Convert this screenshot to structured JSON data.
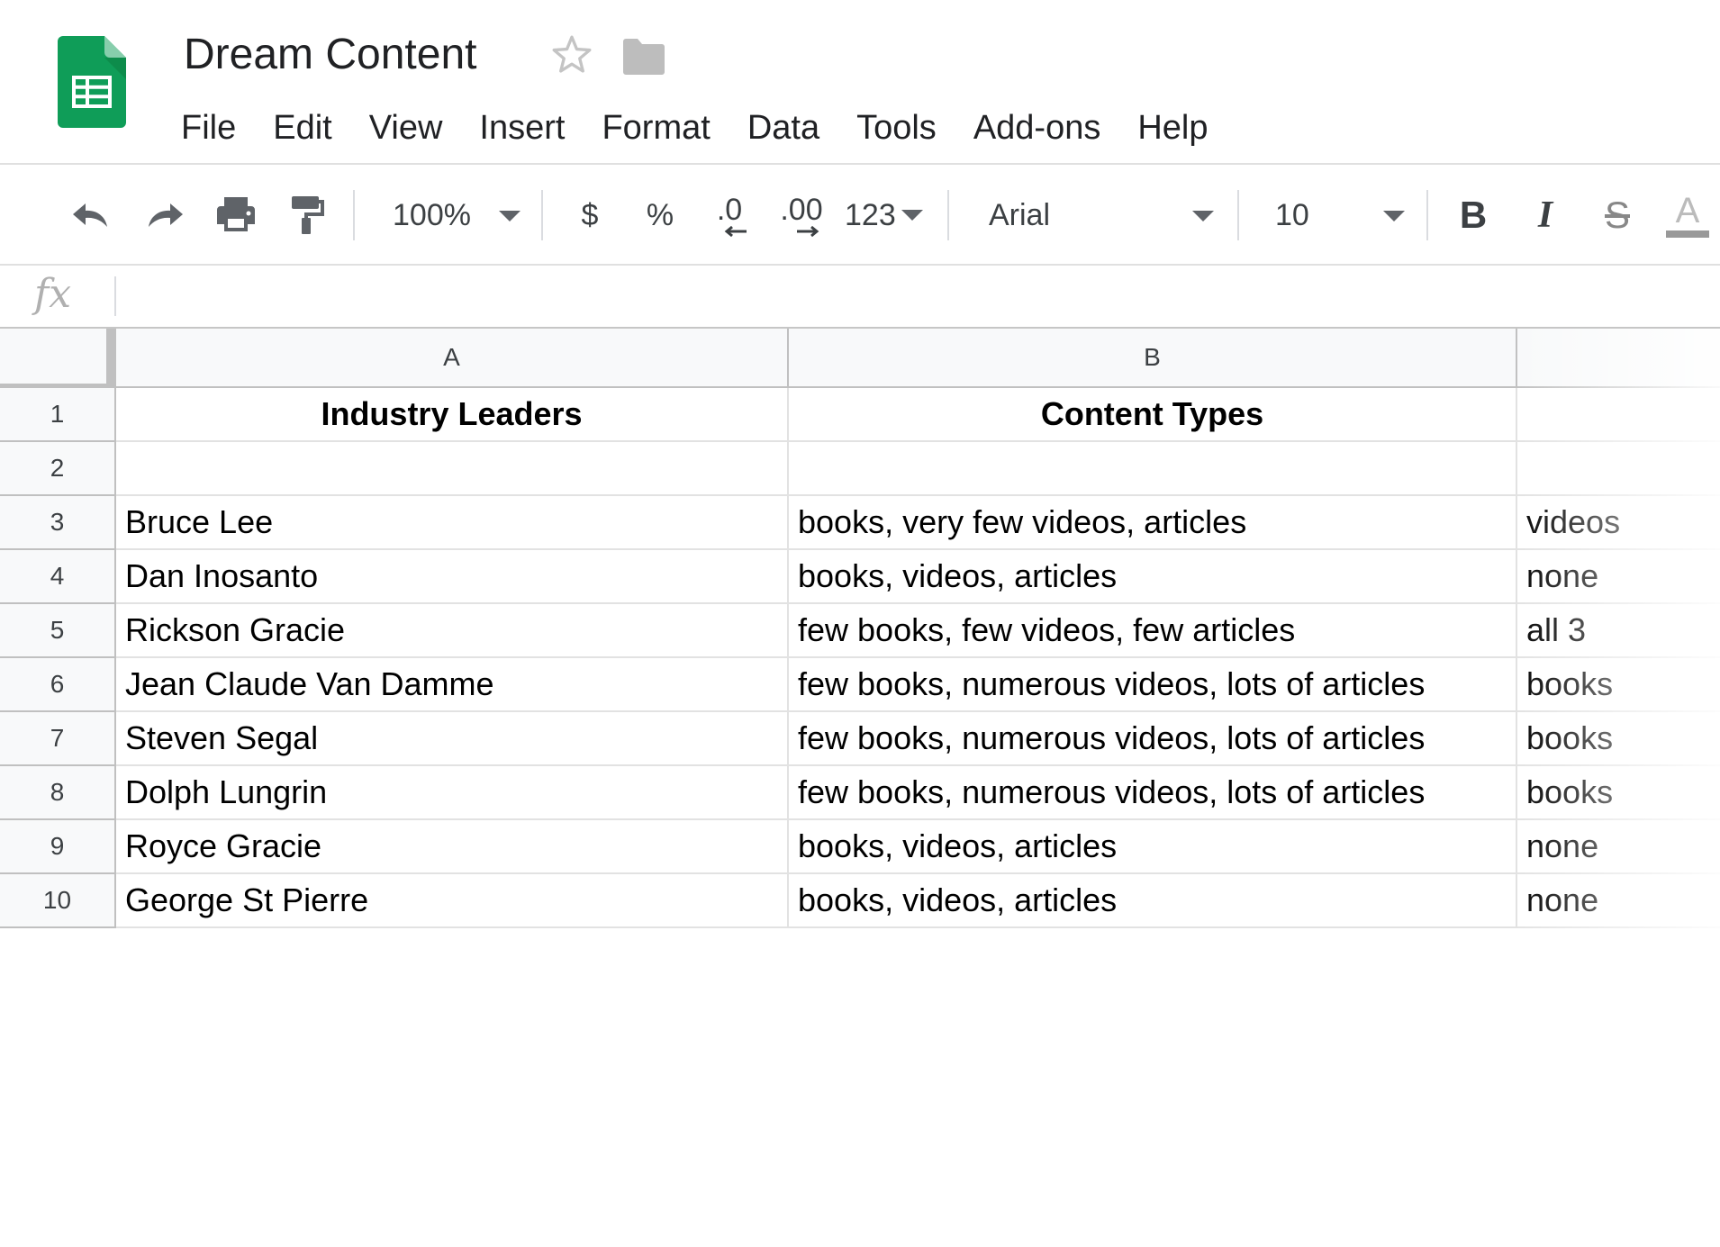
{
  "doc": {
    "title": "Dream Content"
  },
  "menu": [
    "File",
    "Edit",
    "View",
    "Insert",
    "Format",
    "Data",
    "Tools",
    "Add-ons",
    "Help"
  ],
  "toolbar": {
    "zoom": "100%",
    "currency": "$",
    "percent": "%",
    "decrease_decimal": ".0",
    "increase_decimal": ".00",
    "more_formats": "123",
    "font": "Arial",
    "font_size": "10",
    "bold": "B",
    "italic": "I",
    "strike": "S",
    "text_color": "A"
  },
  "formula": {
    "label": "fx",
    "value": ""
  },
  "columns": [
    "A",
    "B"
  ],
  "rows": [
    {
      "num": "1",
      "a": "Industry Leaders",
      "b": "Content Types",
      "c": ""
    },
    {
      "num": "2",
      "a": "",
      "b": "",
      "c": ""
    },
    {
      "num": "3",
      "a": "Bruce Lee",
      "b": "books, very few videos, articles",
      "c": "videos"
    },
    {
      "num": "4",
      "a": "Dan Inosanto",
      "b": "books, videos, articles",
      "c": "none"
    },
    {
      "num": "5",
      "a": "Rickson Gracie",
      "b": "few books, few videos, few articles",
      "c": "all 3"
    },
    {
      "num": "6",
      "a": "Jean Claude Van Damme",
      "b": "few books, numerous videos, lots of articles",
      "c": "books"
    },
    {
      "num": "7",
      "a": "Steven Segal",
      "b": "few books, numerous videos, lots of articles",
      "c": "books"
    },
    {
      "num": "8",
      "a": "Dolph Lungrin",
      "b": "few books, numerous videos, lots of articles",
      "c": "books"
    },
    {
      "num": "9",
      "a": "Royce Gracie",
      "b": "books, videos, articles",
      "c": "none"
    },
    {
      "num": "10",
      "a": "George St Pierre",
      "b": "books, videos, articles",
      "c": "none"
    }
  ],
  "colors": {
    "sheets_green": "#0f9d58",
    "header_bg": "#f8f9fa",
    "grid_line": "#e2e2e2",
    "header_border": "#c0c0c0"
  }
}
